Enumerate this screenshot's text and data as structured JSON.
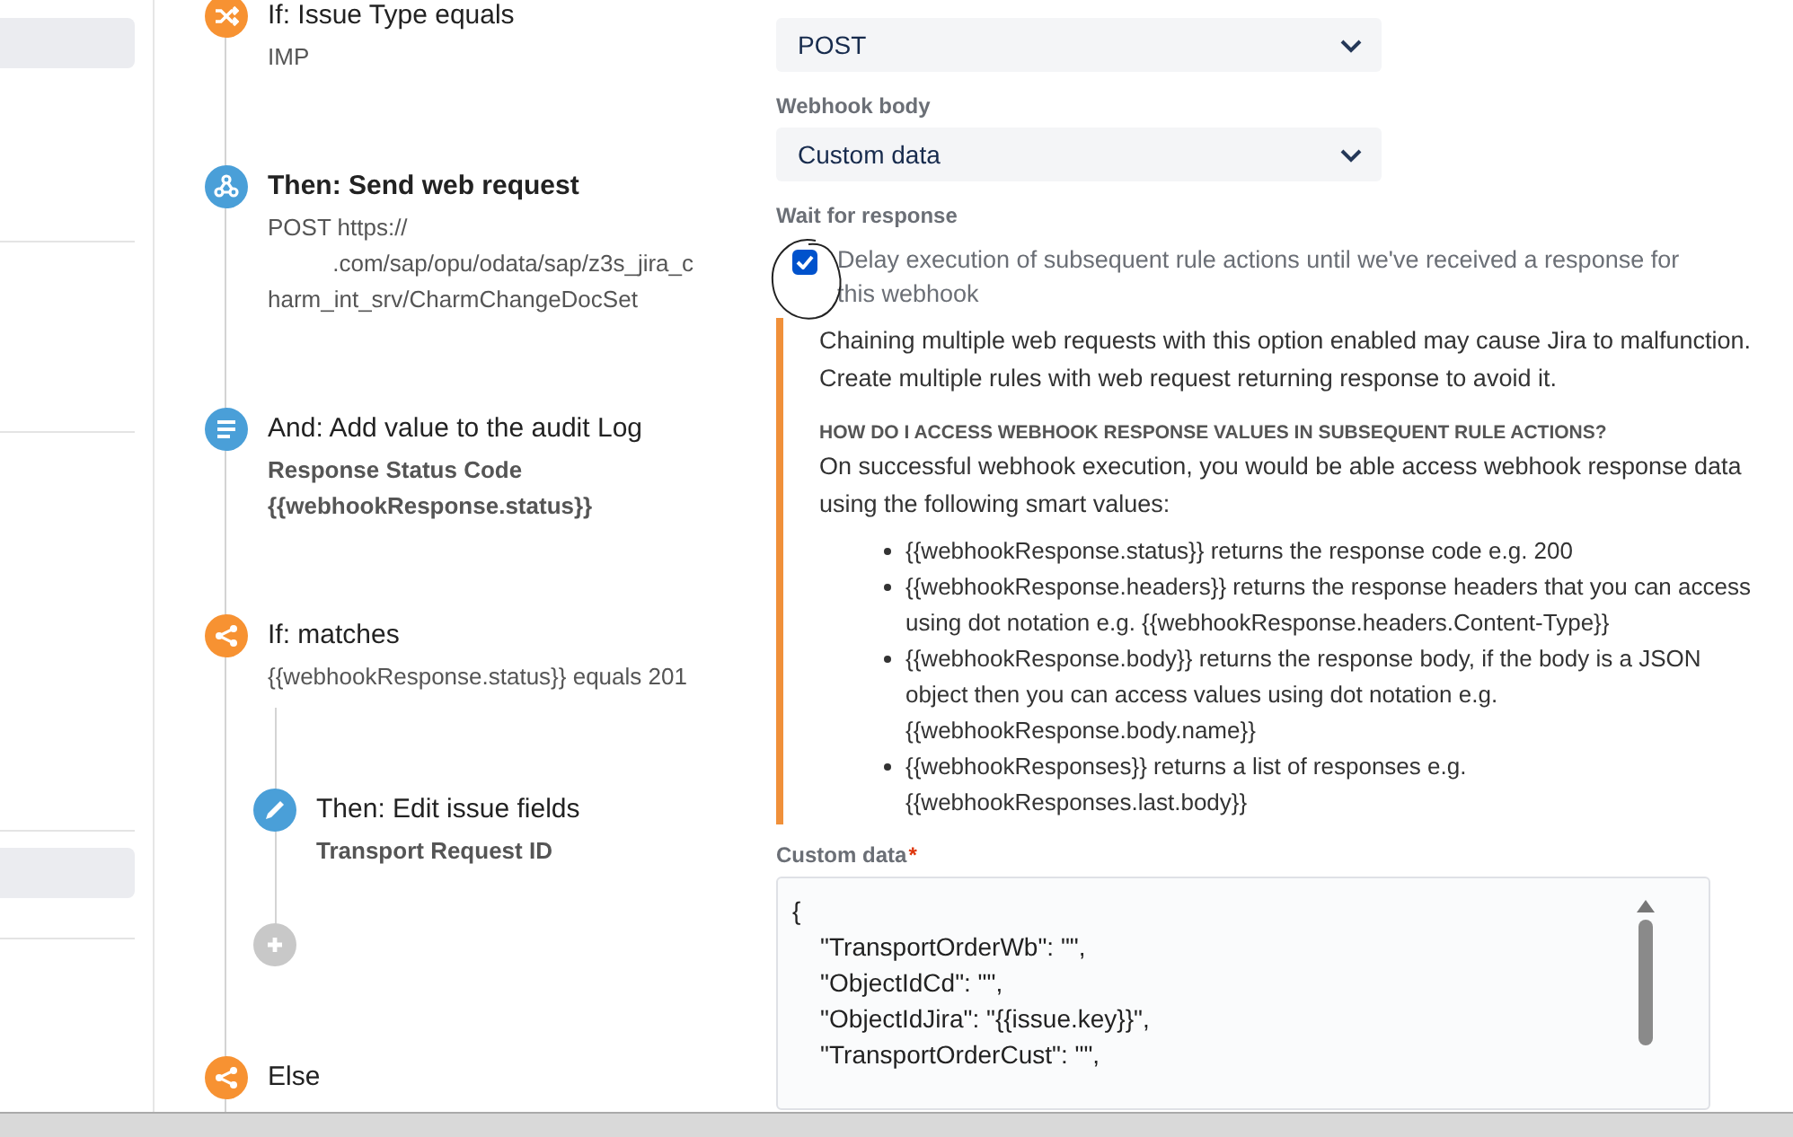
{
  "rule_steps": [
    {
      "kind": "condition",
      "title": "If: Issue Type equals",
      "title_bold": false,
      "detail": "IMP",
      "detail_bold": false
    },
    {
      "kind": "webhook",
      "title": "Then: Send web request",
      "title_bold": true,
      "detail": "POST https://\n          .com/sap/opu/odata/sap/z3s_jira_c\nharm_int_srv/CharmChangeDocSet",
      "detail_bold": false
    },
    {
      "kind": "log",
      "title": "And: Add value to the audit Log",
      "title_bold": false,
      "detail": "Response Status Code\n{{webhookResponse.status}}",
      "detail_bold": true
    },
    {
      "kind": "branch",
      "title": "If: matches",
      "title_bold": false,
      "detail": "{{webhookResponse.status}} equals 201",
      "detail_bold": false,
      "children": [
        {
          "kind": "edit",
          "title": "Then: Edit issue fields",
          "title_bold": false,
          "detail": "Transport Request ID",
          "detail_bold": true
        },
        {
          "kind": "add"
        }
      ]
    },
    {
      "kind": "branch",
      "title": "Else",
      "title_bold": false
    }
  ],
  "config": {
    "http_method": {
      "value": "POST"
    },
    "webhook_body": {
      "label": "Webhook body",
      "value": "Custom data"
    },
    "wait_for_response": {
      "label": "Wait for response",
      "checked": true,
      "text": "Delay execution of subsequent rule actions until we've received a response for this webhook"
    },
    "warning": {
      "text": "Chaining multiple web requests with this option enabled may cause Jira to malfunction. Create multiple rules with web request returning response to avoid it.",
      "heading": "HOW DO I ACCESS WEBHOOK RESPONSE VALUES IN SUBSEQUENT RULE ACTIONS?",
      "intro": "On successful webhook execution, you would be able access webhook response data using the following smart values:",
      "bullets": [
        "{{webhookResponse.status}} returns the response code e.g. 200",
        "{{webhookResponse.headers}} returns the response headers that you can access using dot notation e.g. {{webhookResponse.headers.Content-Type}}",
        "{{webhookResponse.body}} returns the response body, if the body is a JSON object then you can access values using dot notation e.g. {{webhookResponse.body.name}}",
        "{{webhookResponses}} returns a list of responses e.g. {{webhookResponses.last.body}}"
      ]
    },
    "custom_data": {
      "label": "Custom data",
      "required_mark": "*",
      "lines": [
        "{",
        "    \"TransportOrderWb\": \"\",",
        "    \"ObjectIdCd\": \"\",",
        "    \"ObjectIdJira\": \"{{issue.key}}\",",
        "    \"TransportOrderCust\": \"\","
      ]
    }
  }
}
